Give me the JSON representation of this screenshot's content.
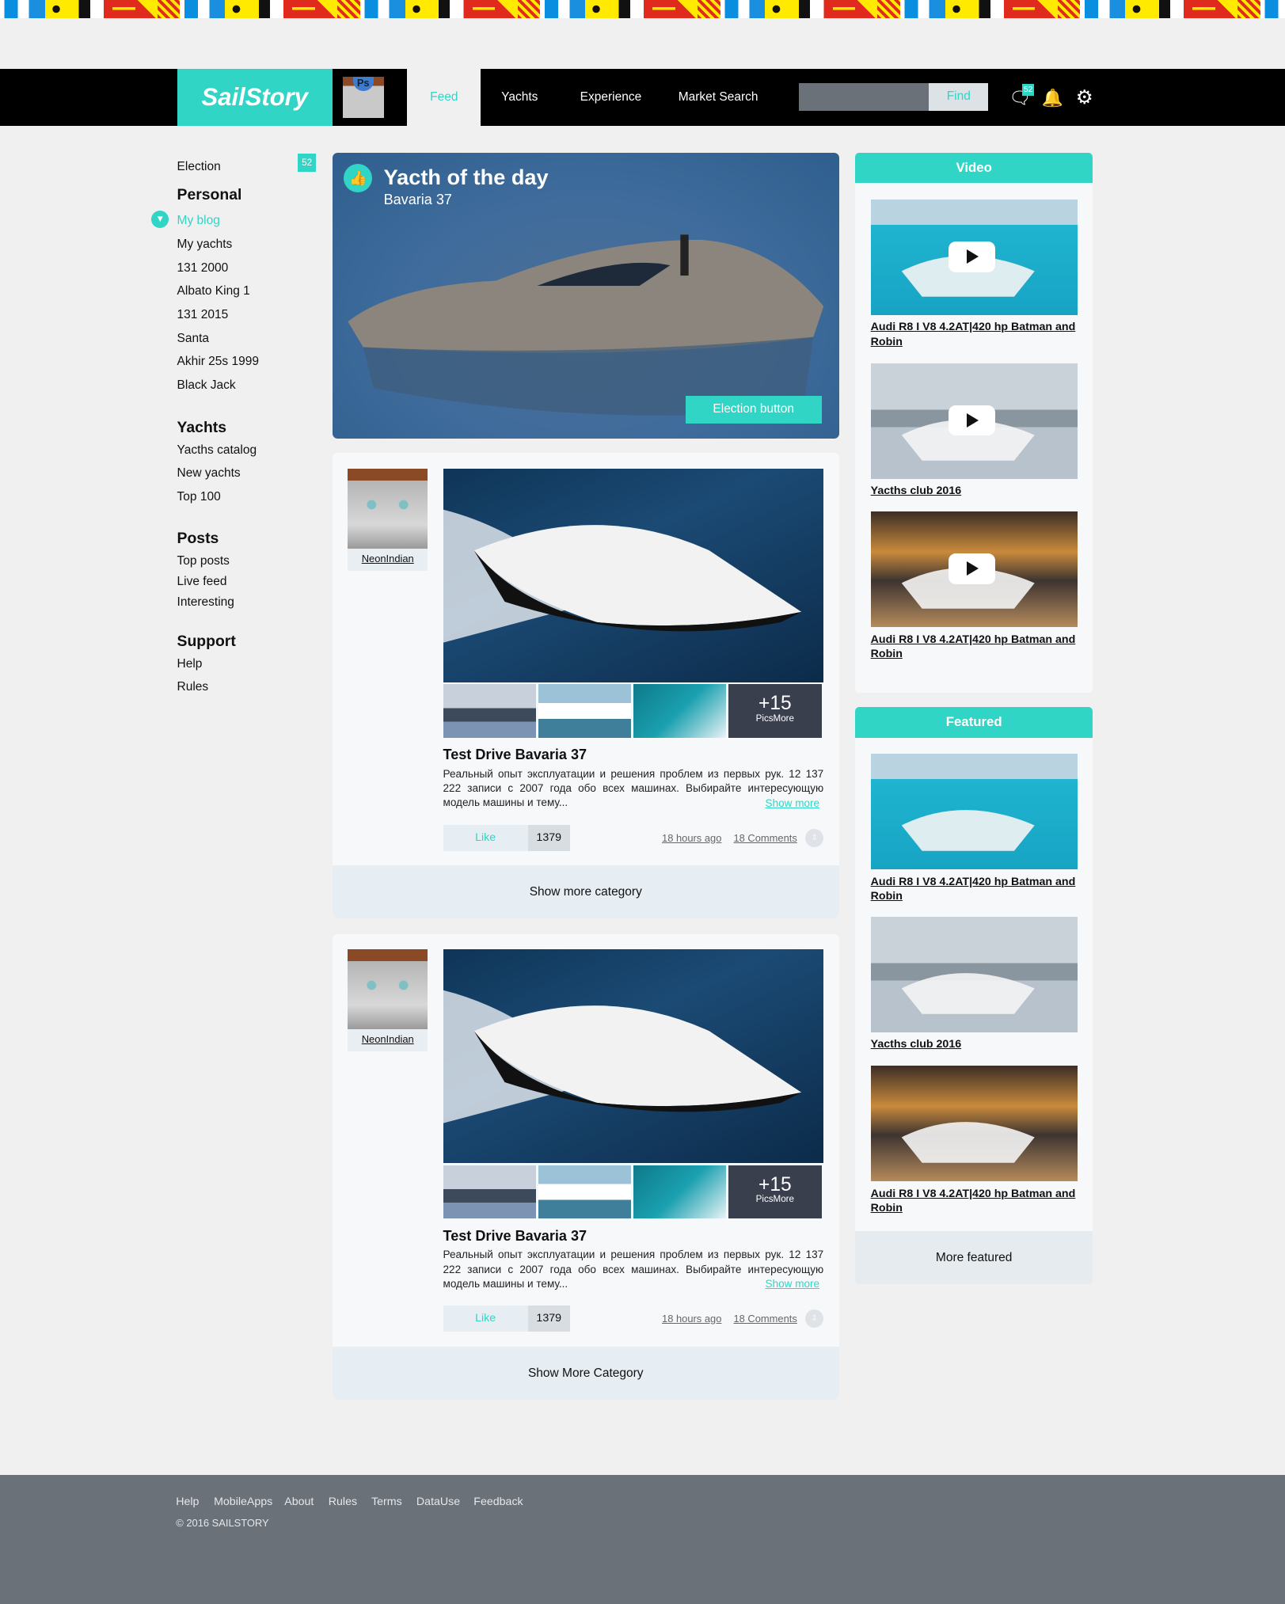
{
  "header": {
    "logo": "SailStory",
    "nav": [
      "Feed",
      "Yachts",
      "Experience",
      "Market Search"
    ],
    "search_placeholder": "",
    "find": "Find",
    "chat_badge": "52"
  },
  "sidebar": {
    "election": "Election",
    "election_badge": "52",
    "sections": [
      {
        "title": "Personal",
        "items": [
          "My blog",
          "My yachts",
          "131 2000",
          "Albato King 1",
          "131 2015",
          "Santa",
          "Akhir 25s 1999",
          "Black Jack"
        ]
      },
      {
        "title": "Yachts",
        "items": [
          "Yacths catalog",
          "New yachts",
          "Top 100"
        ]
      },
      {
        "title": "Posts",
        "items": [
          "Top posts",
          "Live feed",
          "Interesting"
        ]
      },
      {
        "title": "Support",
        "items": [
          "Help",
          "Rules"
        ]
      }
    ]
  },
  "hero": {
    "title": "Yacth of the day",
    "subtitle": "Bavaria 37",
    "button": "Election button"
  },
  "posts": [
    {
      "author": "NeonIndian",
      "more_count": "+15",
      "more_label": "PicsMore",
      "title": "Test Drive Bavaria 37",
      "text": "Реальный опыт эксплуатации и решения проблем из первых рук. 12 137 222 записи с 2007 года обо всех машинах. Выбирайте интересующую модель машины и тему...",
      "show_more": "Show more",
      "like": "Like",
      "likes": "1379",
      "time": "18 hours ago",
      "comments": "18 Comments",
      "footer": "Show more category"
    },
    {
      "author": "NeonIndian",
      "more_count": "+15",
      "more_label": "PicsMore",
      "title": "Test Drive Bavaria 37",
      "text": "Реальный опыт эксплуатации и решения проблем из первых рук. 12 137 222 записи с 2007 года обо всех машинах. Выбирайте интересующую модель машины и тему...",
      "show_more": "Show more",
      "like": "Like",
      "likes": "1379",
      "time": "18 hours ago",
      "comments": "18 Comments",
      "footer": "Show More Category"
    }
  ],
  "video": {
    "title": "Video",
    "items": [
      "Audi R8 I V8 4.2AT|420 hp Batman and Robin",
      "Yacths club 2016",
      "Audi R8 I V8 4.2AT|420 hp Batman and Robin"
    ]
  },
  "featured": {
    "title": "Featured",
    "items": [
      "Audi R8 I V8 4.2AT|420 hp Batman and Robin",
      "Yacths club 2016",
      "Audi R8 I V8 4.2AT|420 hp Batman and Robin"
    ],
    "more": "More featured"
  },
  "footer": {
    "links": [
      "Help",
      "MobileApps",
      "About",
      "Rules",
      "Terms",
      "DataUse",
      "Feedback"
    ],
    "copyright": "© 2016 SAILSTORY"
  },
  "colors": {
    "accent": "#31d5c6",
    "header": "#000000",
    "footer": "#6b7178"
  }
}
